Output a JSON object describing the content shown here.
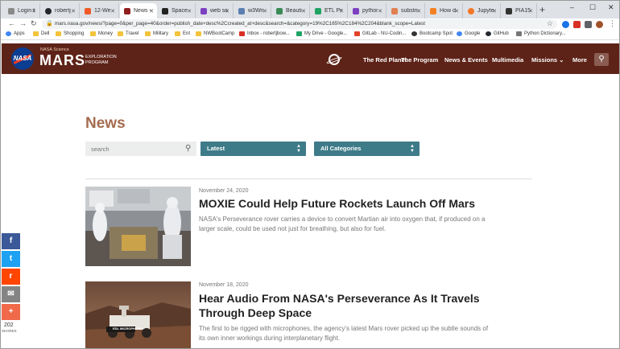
{
  "browser": {
    "tabs": [
      {
        "label": "Login t",
        "color": "#8a8a8a"
      },
      {
        "label": "robertj",
        "color": "#24292e"
      },
      {
        "label": "12-We",
        "color": "#f05a28"
      },
      {
        "label": "News -",
        "color": "#8f1e1e"
      },
      {
        "label": "Space",
        "color": "#222222"
      },
      {
        "label": "web sc",
        "color": "#7b3fc0"
      },
      {
        "label": "w3Wri",
        "color": "#5b7fb0"
      },
      {
        "label": "Beauti",
        "color": "#3a8a55"
      },
      {
        "label": "ETL Pr",
        "color": "#1fa463"
      },
      {
        "label": "pythor",
        "color": "#7b3fc0"
      },
      {
        "label": "substri",
        "color": "#e08050"
      },
      {
        "label": "How d",
        "color": "#f48024"
      },
      {
        "label": "Jupyte",
        "color": "#f37726"
      },
      {
        "label": "PIA15",
        "color": "#333333"
      }
    ],
    "new_tab": "+",
    "window_controls": [
      "–",
      "☐",
      "✕"
    ],
    "url": "mars.nasa.gov/news/?page=0&per_page=40&order=publish_date+desc%2Ccreated_at+desc&search=&category=19%2C165%2C184%2C204&blank_scope=Latest",
    "bookmarks": [
      "Apps",
      "Dell",
      "Shopping",
      "Money",
      "Travel",
      "Military",
      "Ent",
      "NWBootCamp",
      "Inbox - robertjbow...",
      "My Drive - Google...",
      "GitLab - NU-Codin...",
      "Bootcamp Spot",
      "Google",
      "GitHub",
      "Python Dictionary..."
    ]
  },
  "site": {
    "logo_text": "NASA",
    "brand_science": "NASA Science",
    "brand_mars": "MARS",
    "brand_program": "EXPLORATION PROGRAM",
    "nav": [
      "The Red Planet",
      "The Program",
      "News & Events",
      "Multimedia",
      "Missions ⌄",
      "More"
    ]
  },
  "main": {
    "title": "News",
    "search_placeholder": "search",
    "filter_sort": "Latest",
    "filter_category": "All Categories",
    "articles": [
      {
        "date": "November 24, 2020",
        "title": "MOXIE Could Help Future Rockets Launch Off Mars",
        "summary": "NASA's Perseverance rover carries a device to convert Martian air into oxygen that, if produced on a larger scale, could be used not just for breathing, but also for fuel."
      },
      {
        "date": "November 18, 2020",
        "title": "Hear Audio From NASA's Perseverance As It Travels Through Deep Space",
        "summary": "The first to be rigged with microphones, the agency's latest Mars rover picked up the subtle sounds of its own inner workings during interplanetary flight.",
        "image_caption": "EDL MICROPHONE"
      }
    ]
  },
  "share": {
    "count": "202",
    "label": "SHARES",
    "buttons": [
      {
        "glyph": "f",
        "color": "#3b5998"
      },
      {
        "glyph": "t",
        "color": "#1da1f2"
      },
      {
        "glyph": "r",
        "color": "#ff4500"
      },
      {
        "glyph": "✉",
        "color": "#848484"
      },
      {
        "glyph": "+",
        "color": "#f06a4a"
      }
    ]
  }
}
